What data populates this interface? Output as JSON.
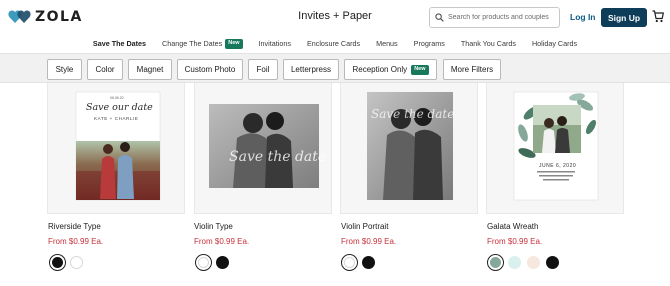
{
  "header": {
    "logo_text": "ZOLA",
    "section_title": "Invites + Paper",
    "search_placeholder": "Search for products and couples",
    "login_label": "Log In",
    "signup_label": "Sign Up"
  },
  "subnav": {
    "items": [
      {
        "label": "Save The Dates",
        "active": true
      },
      {
        "label": "Change The Dates",
        "badge": "New"
      },
      {
        "label": "Invitations"
      },
      {
        "label": "Enclosure Cards"
      },
      {
        "label": "Menus"
      },
      {
        "label": "Programs"
      },
      {
        "label": "Thank You Cards"
      },
      {
        "label": "Holiday Cards"
      }
    ]
  },
  "filters": {
    "chips": [
      {
        "label": "Style"
      },
      {
        "label": "Color"
      },
      {
        "label": "Magnet"
      },
      {
        "label": "Custom Photo"
      },
      {
        "label": "Foil"
      },
      {
        "label": "Letterpress"
      },
      {
        "label": "Reception Only",
        "badge": "New"
      },
      {
        "label": "More Filters"
      }
    ]
  },
  "products": [
    {
      "name": "Riverside Type",
      "price": "From $0.99 Ea.",
      "card_text": {
        "script": "Save our date",
        "names": "KATE + CHARLIE",
        "date": "06.06.20"
      },
      "swatches": [
        "#111111",
        "#ffffff"
      ]
    },
    {
      "name": "Violin Type",
      "price": "From $0.99 Ea.",
      "card_text": {
        "script": "Save the date"
      },
      "swatches": [
        "#ffffff",
        "#111111"
      ]
    },
    {
      "name": "Violin Portrait",
      "price": "From $0.99 Ea.",
      "card_text": {
        "script": "Save the date"
      },
      "swatches": [
        "#ffffff",
        "#111111"
      ]
    },
    {
      "name": "Galata Wreath",
      "price": "From $0.99 Ea.",
      "card_text": {
        "date": "JUNE 6, 2020"
      },
      "swatches": [
        "#86a89a",
        "#d9f0ee",
        "#f6e8de",
        "#111111"
      ]
    }
  ],
  "colors": {
    "brand_navy": "#0e3d5a",
    "link_blue": "#0e5a8a",
    "badge_green": "#17785c",
    "price_red": "#c8323a",
    "logo_heart": "#3e9bbd"
  }
}
